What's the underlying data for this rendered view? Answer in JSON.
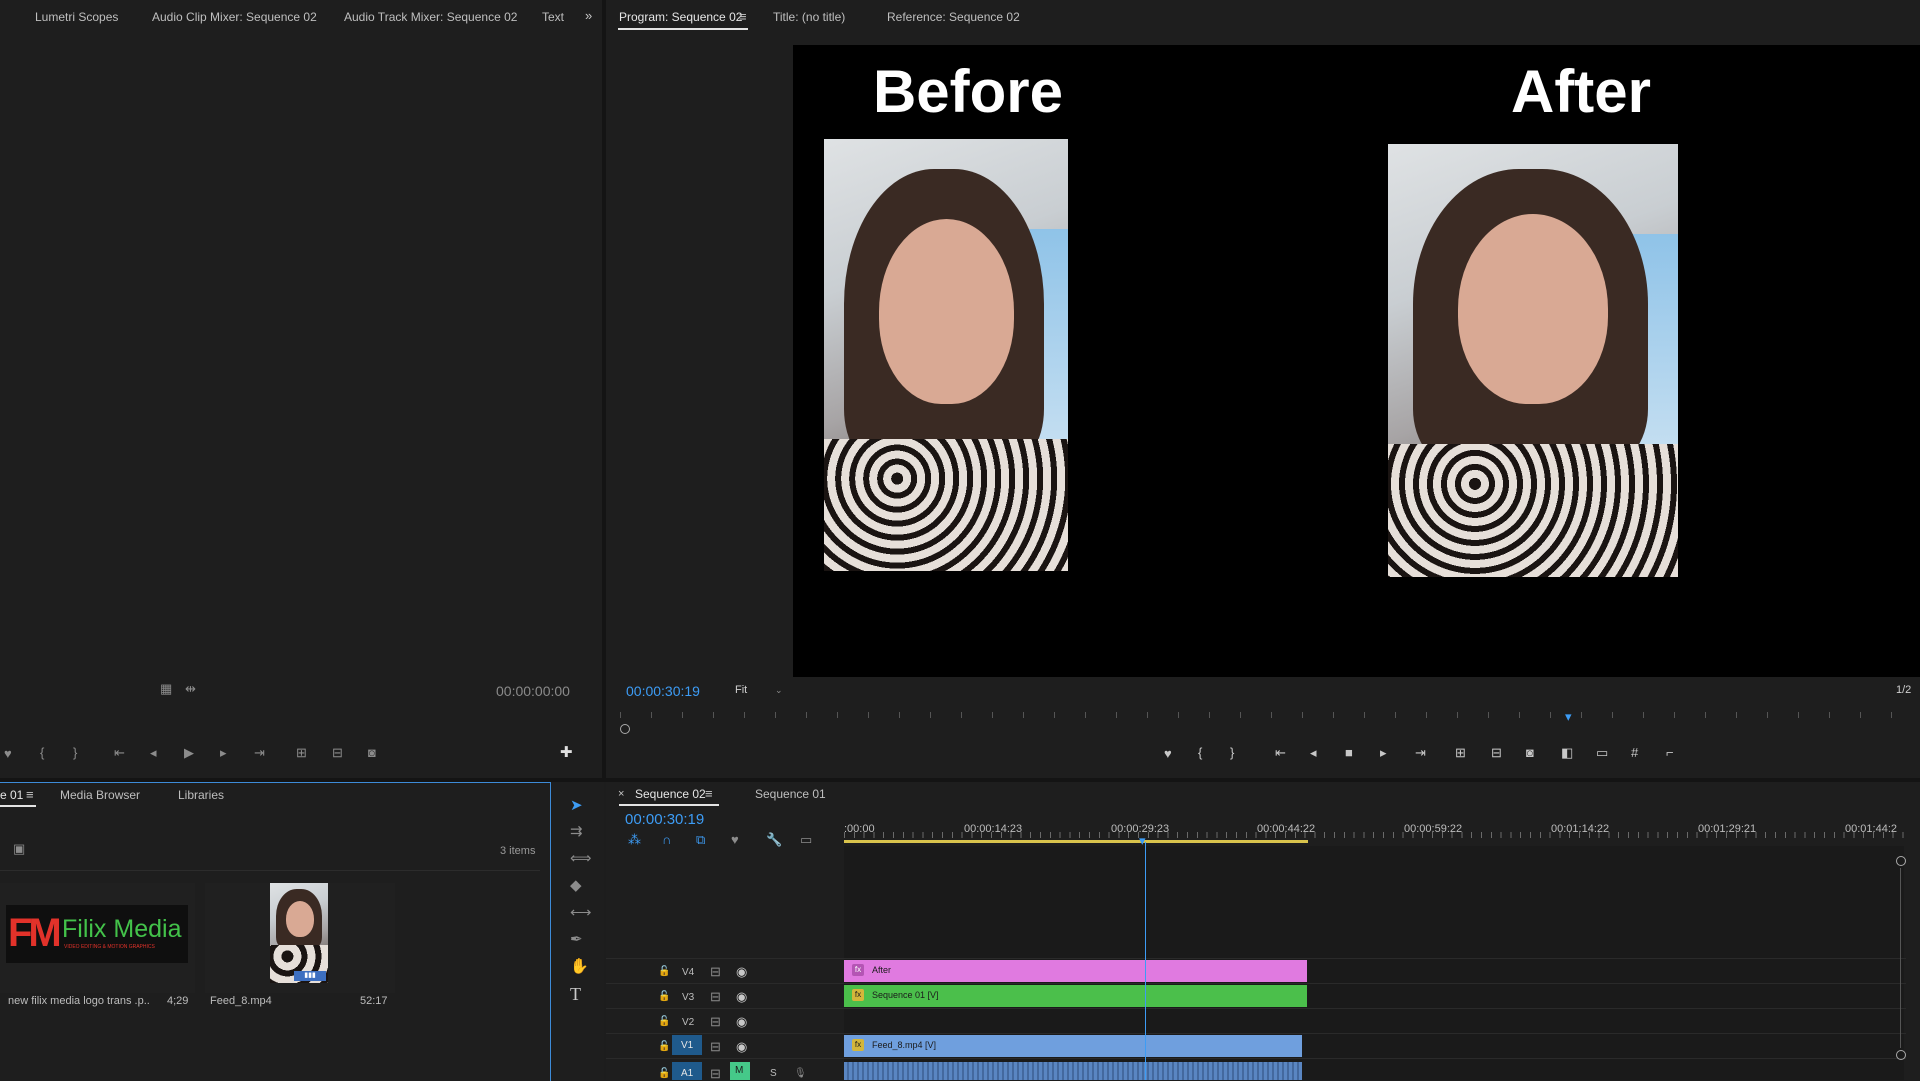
{
  "source_panel": {
    "tabs": [
      "Lumetri Scopes",
      "Audio Clip Mixer: Sequence 02",
      "Audio Track Mixer: Sequence 02",
      "Text"
    ],
    "timecode": "00:00:00:00",
    "overflow_icon": "chevron-double-right-icon"
  },
  "program_panel": {
    "tabs": [
      "Program: Sequence 02",
      "Title: (no title)",
      "Reference: Sequence 02"
    ],
    "active_tab": "Program: Sequence 02",
    "timecode": "00:00:30:19",
    "zoom": "Fit",
    "resolution": "1/2",
    "captions": {
      "before": "Before",
      "after": "After"
    }
  },
  "project_panel": {
    "tabs": [
      "e 01",
      "Media Browser",
      "Libraries"
    ],
    "items_count": "3 items",
    "items": [
      {
        "name": "new filix media  logo trans .p..",
        "duration": "4;29",
        "logo_text": "Filix Media",
        "logo_sub": "VIDEO EDITING & MOTION GRAPHICS",
        "logo_mark": "FM"
      },
      {
        "name": "Feed_8.mp4",
        "duration": "52:17"
      }
    ]
  },
  "timeline": {
    "tabs": [
      "Sequence 02",
      "Sequence 01"
    ],
    "active_tab": "Sequence 02",
    "timecode": "00:00:30:19",
    "ruler": [
      ":00:00",
      "00:00:14:23",
      "00:00:29:23",
      "00:00:44:22",
      "00:00:59:22",
      "00:01:14:22",
      "00:01:29:21",
      "00:01:44:2"
    ],
    "tracks": [
      {
        "label": "V4",
        "clip": "After",
        "color": "#e07ae0"
      },
      {
        "label": "V3",
        "clip": "Sequence 01 [V]",
        "color": "#4bbf4b"
      },
      {
        "label": "V2",
        "clip": "",
        "color": ""
      },
      {
        "label": "V1",
        "clip": "Feed_8.mp4 [V]",
        "color": "#6f9fde"
      },
      {
        "label": "A1",
        "clip": "",
        "color": "#5a86c2"
      }
    ],
    "audio_buttons": {
      "mute": "M",
      "solo": "S"
    }
  },
  "colors": {
    "accent_blue": "#3d9cf5",
    "panel_bg": "#1e1e1e"
  }
}
